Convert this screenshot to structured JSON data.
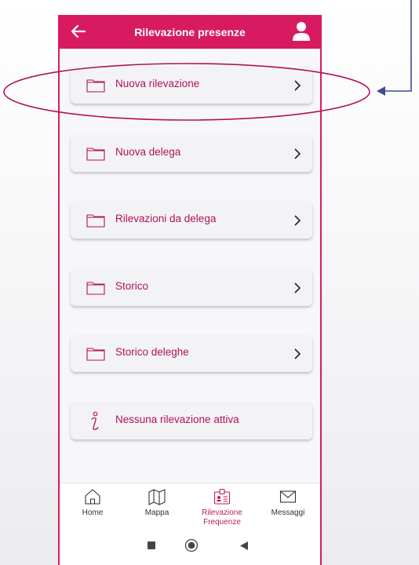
{
  "header": {
    "title": "Rilevazione presenze",
    "back_icon": "arrow-left-icon",
    "user_icon": "user-icon"
  },
  "menu": {
    "items": [
      {
        "label": "Nuova rilevazione",
        "icon": "folder-icon"
      },
      {
        "label": "Nuova delega",
        "icon": "folder-icon"
      },
      {
        "label": "Rilevazioni da delega",
        "icon": "folder-icon"
      },
      {
        "label": "Storico",
        "icon": "folder-icon"
      },
      {
        "label": "Storico deleghe",
        "icon": "folder-icon"
      }
    ],
    "status": {
      "label": "Nessuna rilevazione attiva",
      "icon": "info-icon"
    }
  },
  "bottom_nav": {
    "items": [
      {
        "label": "Home",
        "icon": "home-icon"
      },
      {
        "label": "Mappa",
        "icon": "map-icon"
      },
      {
        "label": "Rilevazione\nFrequenze",
        "icon": "badge-icon",
        "active": true
      },
      {
        "label": "Messaggi",
        "icon": "mail-icon"
      }
    ]
  },
  "colors": {
    "accent": "#d81b60",
    "label": "#b0125a",
    "annotation": "#3a4f8c"
  }
}
